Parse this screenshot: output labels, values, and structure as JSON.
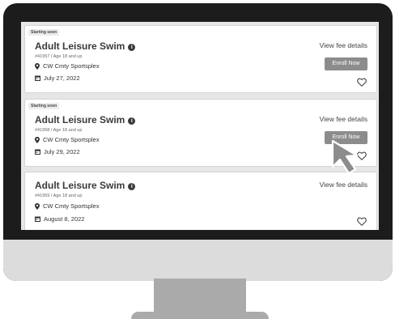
{
  "listings": [
    {
      "badge": "Starting soon",
      "title": "Adult Leisure Swim",
      "meta": "#41957 / Age 18 and up",
      "location": "CW Cmty Sportsplex",
      "date": "July 27, 2022",
      "fee_link": "View fee details",
      "enroll_label": "Enroll Now"
    },
    {
      "badge": "Starting soon",
      "title": "Adult Leisure Swim",
      "meta": "#41958 / Age 18 and up",
      "location": "CW Cmty Sportsplex",
      "date": "July 29, 2022",
      "fee_link": "View fee details",
      "enroll_label": "Enroll Now"
    },
    {
      "title": "Adult Leisure Swim",
      "meta": "#41959 / Age 18 and up",
      "location": "CW Cmty Sportsplex",
      "date": "August 8, 2022",
      "fee_link": "View fee details"
    }
  ],
  "icons": {
    "info": "info-icon",
    "location": "location-pin-icon",
    "calendar": "calendar-icon",
    "favorite": "heart-icon",
    "cursor": "mouse-pointer-icon"
  },
  "colors": {
    "screen_background": "#e6e6e6",
    "card_background": "#ffffff",
    "button": "#8c8c8c",
    "monitor_bezel": "#1c1c1c",
    "monitor_chin": "#dcdcdc",
    "stand": "#aaaaaa"
  }
}
